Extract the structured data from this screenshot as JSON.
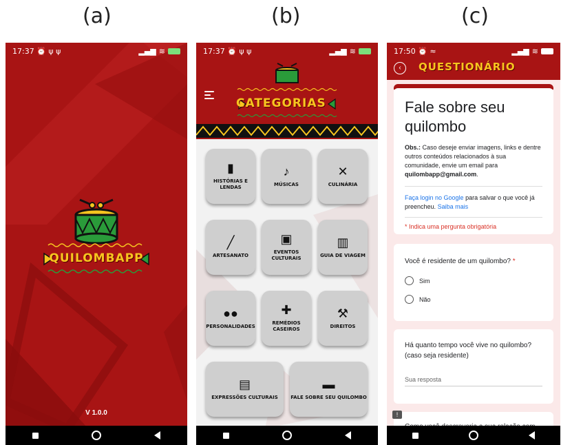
{
  "panels": {
    "a": {
      "label": "(a)"
    },
    "b": {
      "label": "(b)"
    },
    "c": {
      "label": "(c)"
    }
  },
  "splash": {
    "status_time": "17:37",
    "status_icons": "⏰ ψ ψ",
    "app_name": "QUILOMBAPP",
    "version": "V 1.0.0"
  },
  "categories": {
    "status_time": "17:37",
    "status_icons": "⏰ ψ ψ",
    "title": "CATEGORIAS",
    "tiles": [
      {
        "label": "HISTÓRIAS E LENDAS",
        "icon": "book-icon",
        "glyph": "▮"
      },
      {
        "label": "MÚSICAS",
        "icon": "music-note-icon",
        "glyph": "♪"
      },
      {
        "label": "CULINÁRIA",
        "icon": "utensils-icon",
        "glyph": "✕"
      },
      {
        "label": "ARTESANATO",
        "icon": "brush-icon",
        "glyph": "╱"
      },
      {
        "label": "EVENTOS CULTURAIS",
        "icon": "calendar-icon",
        "glyph": "▣"
      },
      {
        "label": "GUIA DE VIAGEM",
        "icon": "buildings-icon",
        "glyph": "▥"
      },
      {
        "label": "PERSONALIDADES",
        "icon": "people-icon",
        "glyph": "●●"
      },
      {
        "label": "REMÉDIOS CASEIROS",
        "icon": "medical-kit-icon",
        "glyph": "✚"
      },
      {
        "label": "DIREITOS",
        "icon": "gavel-icon",
        "glyph": "⚒"
      },
      {
        "label": "EXPRESSÕES CULTURAIS",
        "icon": "id-card-icon",
        "glyph": "▤"
      },
      {
        "label": "FALE SOBRE SEU QUILOMBO",
        "icon": "chat-icon",
        "glyph": "▬"
      }
    ]
  },
  "questionnaire": {
    "status_time": "17:50",
    "status_icons": "⏰ ≈",
    "title": "QUESTIONÁRIO",
    "form_title": "Fale sobre seu quilombo",
    "obs_label": "Obs.:",
    "obs_text": "Caso deseje enviar imagens, links e dentre outros conteúdos relacionados à sua comunidade, envie um email para",
    "email": "quilombapp@gmail.com",
    "login_link": "Faça login no Google",
    "login_text": "para salvar o que você já preencheu.",
    "learn_more": "Saiba mais",
    "required_note": "* Indica uma pergunta obrigatória",
    "q1": {
      "text": "Você é residente de um quilombo?",
      "required_mark": "*",
      "options": [
        "Sim",
        "Não"
      ]
    },
    "q2": {
      "text": "Há quanto tempo você vive no quilombo? (caso seja residente)",
      "placeholder": "Sua resposta"
    },
    "q3": {
      "text": "Como você descreveria a sua relação com"
    }
  },
  "colors": {
    "primary_red": "#a81414",
    "gold": "#f7c51f",
    "tile_gray": "#cfcfcf"
  }
}
